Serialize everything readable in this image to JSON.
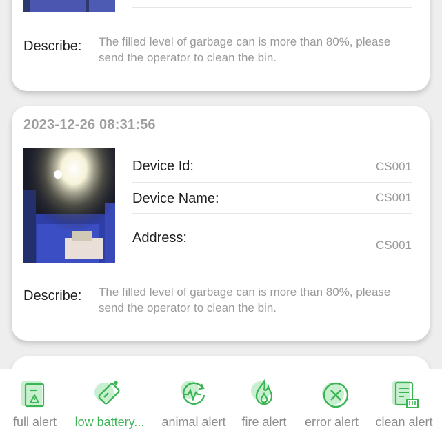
{
  "cards": [
    {
      "describe_label": "Describe:",
      "describe_text": "The filled level of garbage can is more than 80%, please send the operator to clean the bin."
    },
    {
      "datetime": "2023-12-26 08:31:56",
      "fields": [
        {
          "label": "Device Id:",
          "value": "CS001"
        },
        {
          "label": "Device Name:",
          "value": "CS001"
        },
        {
          "label": "Address:",
          "value": "CS001"
        }
      ],
      "describe_label": "Describe:",
      "describe_text": "The filled level of garbage can is more than 80%, please send the operator to clean the bin."
    }
  ],
  "tabs": [
    {
      "label": "full alert",
      "icon": "full-alert-icon"
    },
    {
      "label": "low battery...",
      "icon": "low-battery-icon",
      "active": true
    },
    {
      "label": "animal alert",
      "icon": "animal-alert-icon"
    },
    {
      "label": "fire alert",
      "icon": "fire-alert-icon"
    },
    {
      "label": "error alert",
      "icon": "error-alert-icon"
    },
    {
      "label": "clean alert",
      "icon": "clean-alert-icon"
    }
  ],
  "colors": {
    "accent": "#3bb554",
    "icon_bg": "#c8efcf"
  }
}
